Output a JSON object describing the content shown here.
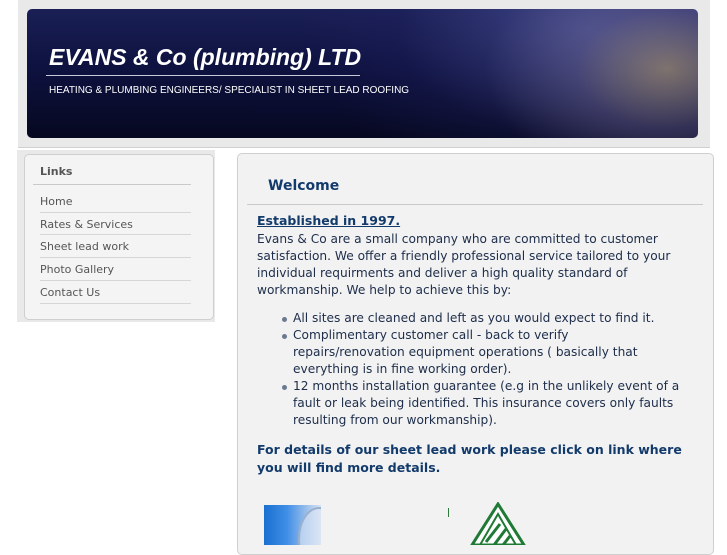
{
  "header": {
    "title": "EVANS & Co (plumbing) LTD",
    "tagline": "HEATING & PLUMBING ENGINEERS/ SPECIALIST IN SHEET LEAD ROOFING"
  },
  "sidebar": {
    "heading": "Links",
    "items": [
      {
        "label": "Home"
      },
      {
        "label": "Rates & Services"
      },
      {
        "label": "Sheet lead work"
      },
      {
        "label": "Photo Gallery"
      },
      {
        "label": "Contact Us"
      }
    ]
  },
  "main": {
    "heading": "Welcome",
    "established": "Established in 1997.",
    "intro": "Evans & Co are a small company who are committed to customer satisfaction. We offer a friendly professional service tailored to your individual requirments and deliver a high quality standard of workmanship. We help to achieve this by:",
    "bullets": [
      "All sites are cleaned and left as you would expect to find it.",
      "Complimentary customer call - back to verify repairs/renovation equipment operations ( basically that everything is in fine working order).",
      "12 months installation guarantee (e.g in the unlikely event of a fault or leak being identified. This insurance covers only faults resulting from our workmanship)."
    ],
    "details": "For details of our sheet lead work please click on link where you will find more details."
  },
  "colors": {
    "heading_blue": "#123a6b",
    "body_text": "#1d2d4a",
    "panel_bg": "#f2f2f2",
    "banner_dark": "#0e1240"
  }
}
